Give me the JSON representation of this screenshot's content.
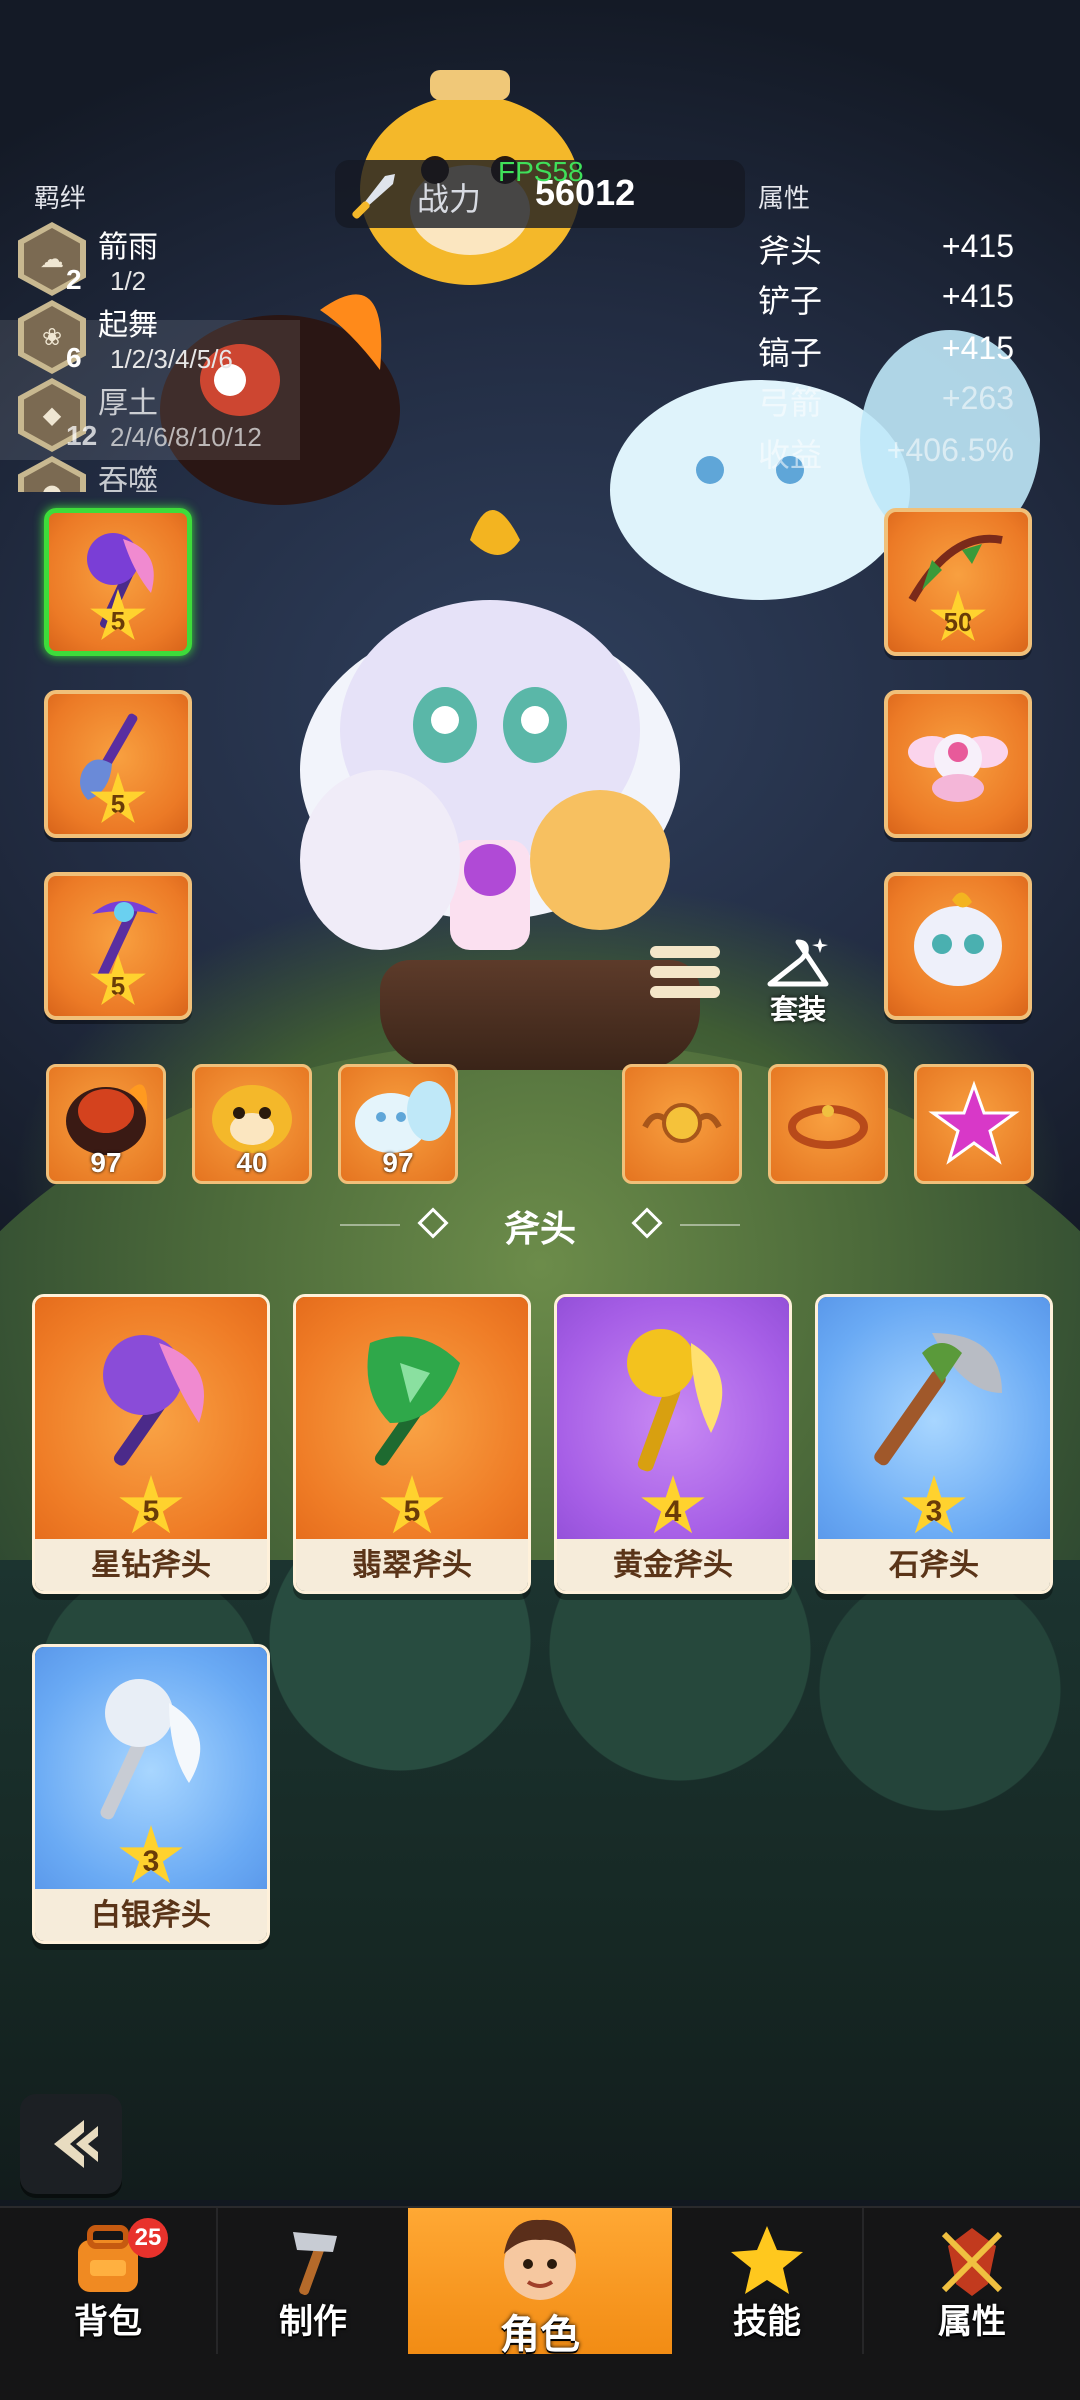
{
  "power_bar": {
    "label": "战力",
    "value": "56012",
    "fps": "FPS58"
  },
  "bonds": {
    "title": "羁绊",
    "items": [
      {
        "name": "箭雨",
        "count": "2",
        "tiers": "1/2"
      },
      {
        "name": "起舞",
        "count": "6",
        "tiers": "1/2/3/4/5/6"
      },
      {
        "name": "厚土",
        "count": "12",
        "tiers": "2/4/6/8/10/12"
      },
      {
        "name": "吞噬",
        "count": "",
        "tiers": ""
      }
    ]
  },
  "attributes": {
    "title": "属性",
    "items": [
      {
        "name": "斧头",
        "value": "+415"
      },
      {
        "name": "铲子",
        "value": "+415"
      },
      {
        "name": "镐子",
        "value": "+415"
      },
      {
        "name": "弓箭",
        "value": "+263"
      },
      {
        "name": "收益",
        "value": "+406.5%"
      }
    ]
  },
  "equipment": {
    "left": [
      {
        "slot": "axe",
        "stars": "5",
        "icon": "purple-spike-axe-icon"
      },
      {
        "slot": "shovel",
        "stars": "5",
        "icon": "purple-shovel-icon"
      },
      {
        "slot": "pickaxe",
        "stars": "5",
        "icon": "purple-pickaxe-icon"
      }
    ],
    "right": [
      {
        "slot": "bow",
        "stars": "50",
        "icon": "green-bow-icon"
      },
      {
        "slot": "wings",
        "icon": "winged-eye-icon"
      },
      {
        "slot": "mask",
        "icon": "dragon-mask-icon"
      }
    ]
  },
  "pets": [
    {
      "name": "fire-lion",
      "level": "97"
    },
    {
      "name": "tiger",
      "level": "40"
    },
    {
      "name": "fox",
      "level": "97"
    }
  ],
  "accessories": [
    {
      "name": "coin-amulet-icon"
    },
    {
      "name": "bracelet-icon"
    },
    {
      "name": "pink-star-icon"
    }
  ],
  "outfit_label": "套装",
  "section_title": "斧头",
  "items": [
    {
      "name": "星钻斧头",
      "stars": "5",
      "rarity": "orange",
      "color": "#8a4cd8"
    },
    {
      "name": "翡翠斧头",
      "stars": "5",
      "rarity": "orange",
      "color": "#2fa84a"
    },
    {
      "name": "黄金斧头",
      "stars": "4",
      "rarity": "purple",
      "color": "#f3c21e"
    },
    {
      "name": "石斧头",
      "stars": "3",
      "rarity": "blue",
      "color": "#b8bcc4"
    },
    {
      "name": "白银斧头",
      "stars": "3",
      "rarity": "blue",
      "color": "#e8eef6"
    }
  ],
  "nav": {
    "items": [
      {
        "label": "背包",
        "badge": "25",
        "icon": "backpack-icon"
      },
      {
        "label": "制作",
        "icon": "hammer-icon"
      },
      {
        "label": "角色",
        "icon": "hero-face-icon",
        "active": true
      },
      {
        "label": "技能",
        "icon": "star-icon"
      },
      {
        "label": "属性",
        "icon": "crossed-swords-icon"
      }
    ]
  }
}
